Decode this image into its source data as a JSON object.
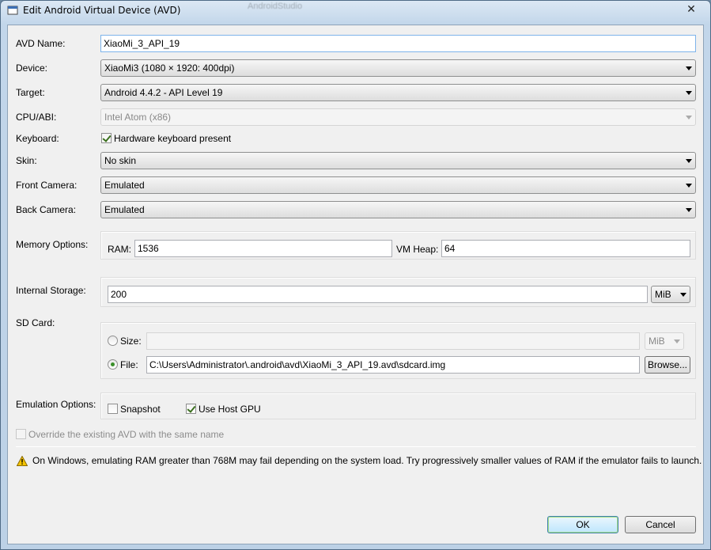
{
  "window": {
    "title": "Edit Android Virtual Device (AVD)",
    "background_title_ghost": "AndroidStudio",
    "close_symbol": "✕"
  },
  "form": {
    "avd_name": {
      "label": "AVD Name:",
      "value": "XiaoMi_3_API_19"
    },
    "device": {
      "label": "Device:",
      "value": "XiaoMi3 (1080 × 1920: 400dpi)"
    },
    "target": {
      "label": "Target:",
      "value": "Android 4.4.2 - API Level 19"
    },
    "cpu_abi": {
      "label": "CPU/ABI:",
      "value": "Intel Atom (x86)"
    },
    "keyboard": {
      "label": "Keyboard:",
      "checkbox_label": "Hardware keyboard present",
      "checked": true
    },
    "skin": {
      "label": "Skin:",
      "value": "No skin"
    },
    "front_camera": {
      "label": "Front Camera:",
      "value": "Emulated"
    },
    "back_camera": {
      "label": "Back Camera:",
      "value": "Emulated"
    },
    "memory": {
      "label": "Memory Options:",
      "ram_label": "RAM:",
      "ram_value": "1536",
      "vm_heap_label": "VM Heap:",
      "vm_heap_value": "64"
    },
    "internal_storage": {
      "label": "Internal Storage:",
      "value": "200",
      "unit": "MiB"
    },
    "sd_card": {
      "label": "SD Card:",
      "size_label": "Size:",
      "size_value": "",
      "size_unit": "MiB",
      "file_label": "File:",
      "file_value": "C:\\Users\\Administrator\\.android\\avd\\XiaoMi_3_API_19.avd\\sdcard.img",
      "browse_label": "Browse...",
      "selected": "file"
    },
    "emulation": {
      "label": "Emulation Options:",
      "snapshot_label": "Snapshot",
      "snapshot_checked": false,
      "host_gpu_label": "Use Host GPU",
      "host_gpu_checked": true
    },
    "override": {
      "label": "Override the existing AVD with the same name",
      "checked": false
    },
    "warning": "On Windows, emulating RAM greater than 768M may fail depending on the system load. Try progressively smaller values of RAM if the emulator fails to launch."
  },
  "buttons": {
    "ok": "OK",
    "cancel": "Cancel"
  },
  "colors": {
    "warning_icon": "#e8b400",
    "title_bar": "#c2d6ea",
    "default_button_glow": "#a8e086"
  }
}
